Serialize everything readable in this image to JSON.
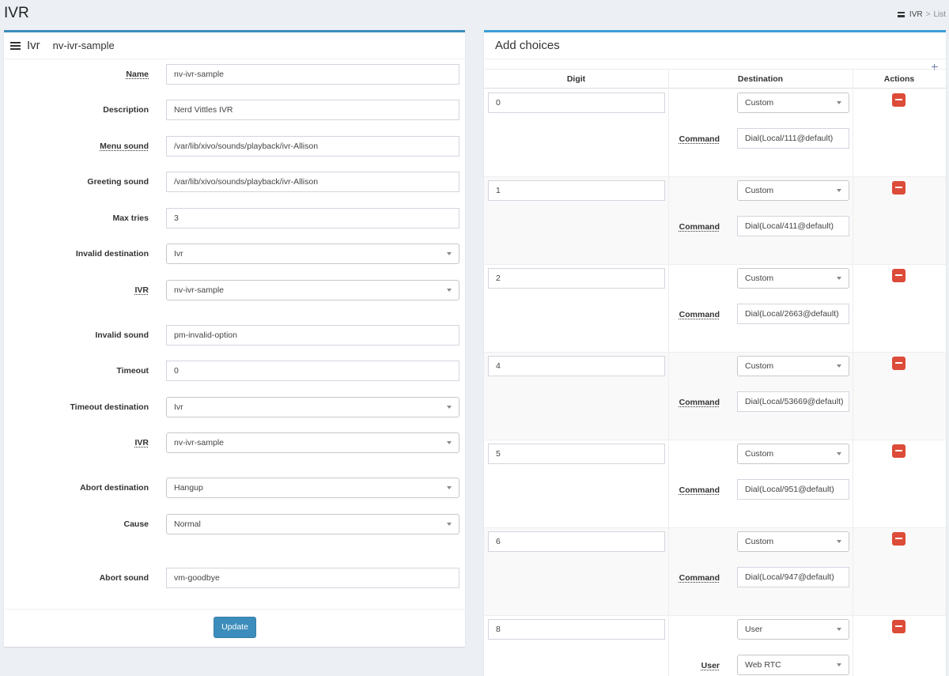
{
  "page": {
    "title": "IVR"
  },
  "breadcrumb": {
    "item1": "IVR",
    "separator": ">",
    "item2": "List"
  },
  "form_panel": {
    "title": "Ivr",
    "subtitle": "nv-ivr-sample",
    "fields": {
      "name": {
        "label": "Name",
        "value": "nv-ivr-sample"
      },
      "description": {
        "label": "Description",
        "value": "Nerd Vittles IVR"
      },
      "menu_sound": {
        "label": "Menu sound",
        "value": "/var/lib/xivo/sounds/playback/ivr-Allison"
      },
      "greeting_sound": {
        "label": "Greeting sound",
        "value": "/var/lib/xivo/sounds/playback/ivr-Allison"
      },
      "max_tries": {
        "label": "Max tries",
        "value": "3"
      },
      "invalid_destination": {
        "label": "Invalid destination",
        "value": "Ivr"
      },
      "invalid_ivr": {
        "label": "IVR",
        "value": "nv-ivr-sample"
      },
      "invalid_sound": {
        "label": "Invalid sound",
        "value": "pm-invalid-option"
      },
      "timeout": {
        "label": "Timeout",
        "value": "0"
      },
      "timeout_destination": {
        "label": "Timeout destination",
        "value": "Ivr"
      },
      "timeout_ivr": {
        "label": "IVR",
        "value": "nv-ivr-sample"
      },
      "abort_destination": {
        "label": "Abort destination",
        "value": "Hangup"
      },
      "cause": {
        "label": "Cause",
        "value": "Normal"
      },
      "abort_sound": {
        "label": "Abort sound",
        "value": "vm-goodbye"
      }
    },
    "update_label": "Update"
  },
  "choices_panel": {
    "title": "Add choices",
    "columns": {
      "digit": "Digit",
      "destination": "Destination",
      "actions": "Actions"
    },
    "rows": [
      {
        "digit": "0",
        "destination": "Custom",
        "sub_label": "Command",
        "sub_value": "Dial(Local/111@default)"
      },
      {
        "digit": "1",
        "destination": "Custom",
        "sub_label": "Command",
        "sub_value": "Dial(Local/411@default)"
      },
      {
        "digit": "2",
        "destination": "Custom",
        "sub_label": "Command",
        "sub_value": "Dial(Local/2663@default)"
      },
      {
        "digit": "4",
        "destination": "Custom",
        "sub_label": "Command",
        "sub_value": "Dial(Local/53669@default)"
      },
      {
        "digit": "5",
        "destination": "Custom",
        "sub_label": "Command",
        "sub_value": "Dial(Local/951@default)"
      },
      {
        "digit": "6",
        "destination": "Custom",
        "sub_label": "Command",
        "sub_value": "Dial(Local/947@default)"
      },
      {
        "digit": "8",
        "destination": "User",
        "sub_label": "User",
        "sub_value": "Web RTC"
      }
    ]
  },
  "icons": {
    "breadcrumb": "list-icon",
    "panel": "hamburger-menu-icon",
    "add": "plus-icon",
    "delete": "minus-icon"
  },
  "colors": {
    "primary": "#3c8dbc",
    "danger": "#dd4b39",
    "background": "#ecf0f5"
  }
}
